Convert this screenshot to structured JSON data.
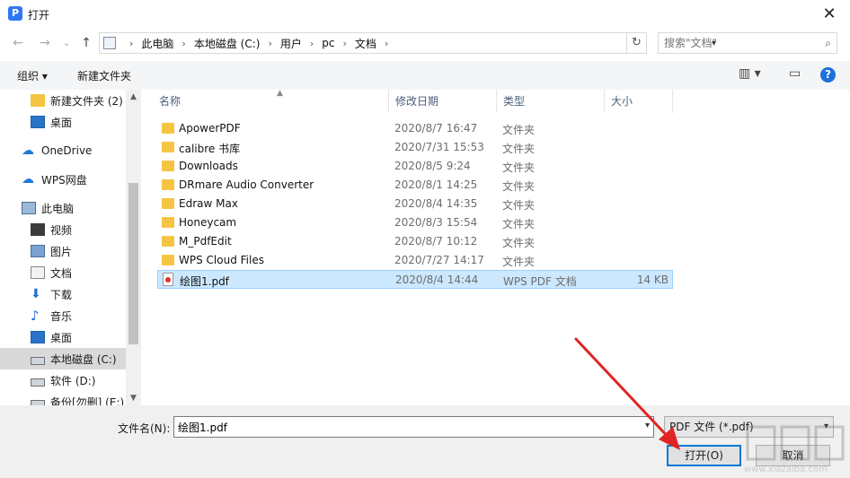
{
  "window": {
    "title": "打开",
    "app_icon": "P",
    "close_symbol": "✕"
  },
  "nav": {
    "back_symbol": "←",
    "forward_symbol": "→",
    "recent_symbol": "⌄",
    "up_symbol": "↑",
    "breadcrumbs": [
      "此电脑",
      "本地磁盘 (C:)",
      "用户",
      "pc",
      "文档"
    ],
    "refresh_symbol": "↻",
    "search_placeholder": "搜索\"文档\""
  },
  "toolbar": {
    "organize_label": "组织 ▾",
    "new_folder_label": "新建文件夹",
    "view_symbol": "▥ ▾",
    "preview_symbol": "▭",
    "help_symbol": "?"
  },
  "sidebar": {
    "items": [
      {
        "label": "新建文件夹 (2)",
        "icon": "folder-icon"
      },
      {
        "label": "桌面",
        "icon": "desktop-icon"
      },
      {
        "label": "OneDrive",
        "icon": "cloud-icon"
      },
      {
        "label": "WPS网盘",
        "icon": "wps-cloud-icon"
      },
      {
        "label": "此电脑",
        "icon": "computer-icon"
      },
      {
        "label": "视频",
        "icon": "video-icon"
      },
      {
        "label": "图片",
        "icon": "picture-icon"
      },
      {
        "label": "文档",
        "icon": "document-icon"
      },
      {
        "label": "下载",
        "icon": "download-icon"
      },
      {
        "label": "音乐",
        "icon": "music-icon"
      },
      {
        "label": "桌面",
        "icon": "desktop-icon"
      },
      {
        "label": "本地磁盘 (C:)",
        "icon": "drive-icon"
      },
      {
        "label": "软件 (D:)",
        "icon": "drive-icon"
      },
      {
        "label": "备份[勿删] (E:)",
        "icon": "drive-icon"
      }
    ],
    "selected_index": 11
  },
  "columns": {
    "name": "名称",
    "date": "修改日期",
    "type": "类型",
    "size": "大小"
  },
  "files": [
    {
      "name": "ApowerPDF",
      "date": "2020/8/7 16:47",
      "type": "文件夹",
      "size": "",
      "kind": "folder"
    },
    {
      "name": "calibre 书库",
      "date": "2020/7/31 15:53",
      "type": "文件夹",
      "size": "",
      "kind": "folder"
    },
    {
      "name": "Downloads",
      "date": "2020/8/5 9:24",
      "type": "文件夹",
      "size": "",
      "kind": "folder"
    },
    {
      "name": "DRmare Audio Converter",
      "date": "2020/8/1 14:25",
      "type": "文件夹",
      "size": "",
      "kind": "folder"
    },
    {
      "name": "Edraw Max",
      "date": "2020/8/4 14:35",
      "type": "文件夹",
      "size": "",
      "kind": "folder"
    },
    {
      "name": "Honeycam",
      "date": "2020/8/3 15:54",
      "type": "文件夹",
      "size": "",
      "kind": "folder"
    },
    {
      "name": "M_PdfEdit",
      "date": "2020/8/7 10:12",
      "type": "文件夹",
      "size": "",
      "kind": "folder"
    },
    {
      "name": "WPS Cloud Files",
      "date": "2020/7/27 14:17",
      "type": "文件夹",
      "size": "",
      "kind": "folder"
    },
    {
      "name": "绘图1.pdf",
      "date": "2020/8/4 14:44",
      "type": "WPS PDF 文档",
      "size": "14 KB",
      "kind": "pdf"
    }
  ],
  "selected_file_index": 8,
  "bottom": {
    "filename_label": "文件名(N):",
    "filename_value": "绘图1.pdf",
    "filetype_value": "PDF 文件 (*.pdf)",
    "open_label": "打开(O)",
    "cancel_label": "取消"
  },
  "watermark": {
    "text": "www.xiazaiba.com"
  },
  "colors": {
    "selection_bg": "#cce8ff",
    "accent": "#0078d7",
    "arrow": "#e02424"
  }
}
